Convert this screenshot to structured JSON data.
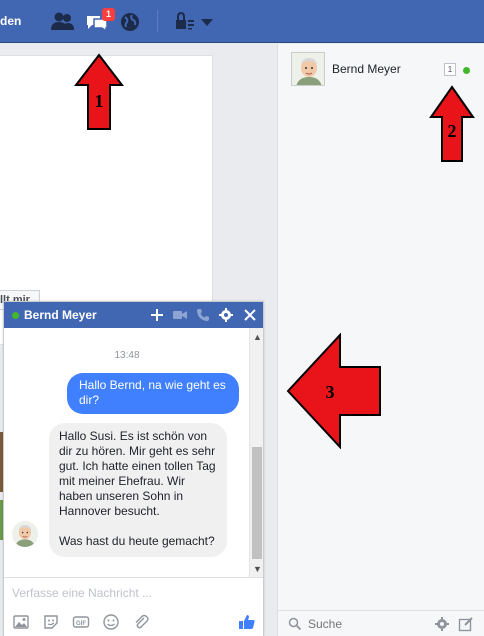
{
  "topbar": {
    "text": "den",
    "notification_count": "1"
  },
  "main": {
    "likes_button_label": "llt mir"
  },
  "sidebar": {
    "contacts": [
      {
        "name": "Bernd Meyer",
        "count": "1",
        "status": "online"
      }
    ],
    "search_placeholder": "Suche"
  },
  "chat": {
    "title": "Bernd Meyer",
    "timestamp": "13:48",
    "messages": [
      {
        "direction": "out",
        "text": "Hallo Bernd, na wie geht es dir?"
      },
      {
        "direction": "in",
        "text": "Hallo Susi. Es ist schön von dir zu hören. Mir geht es sehr gut. Ich hatte einen tollen Tag mit meiner Ehefrau. Wir haben unseren Sohn in Hannover besucht.\n\nWas hast du heute gemacht?"
      }
    ],
    "input_placeholder": "Verfasse eine Nachricht ..."
  },
  "annotations": [
    {
      "label": "1"
    },
    {
      "label": "2"
    },
    {
      "label": "3"
    }
  ],
  "colors": {
    "header_blue": "#4267b2",
    "outgoing_bubble": "#4080ff",
    "incoming_bubble": "#f1f0f0",
    "online_green": "#42b72a",
    "badge_red": "#fa3e3e",
    "arrow_red": "#e8141a"
  }
}
